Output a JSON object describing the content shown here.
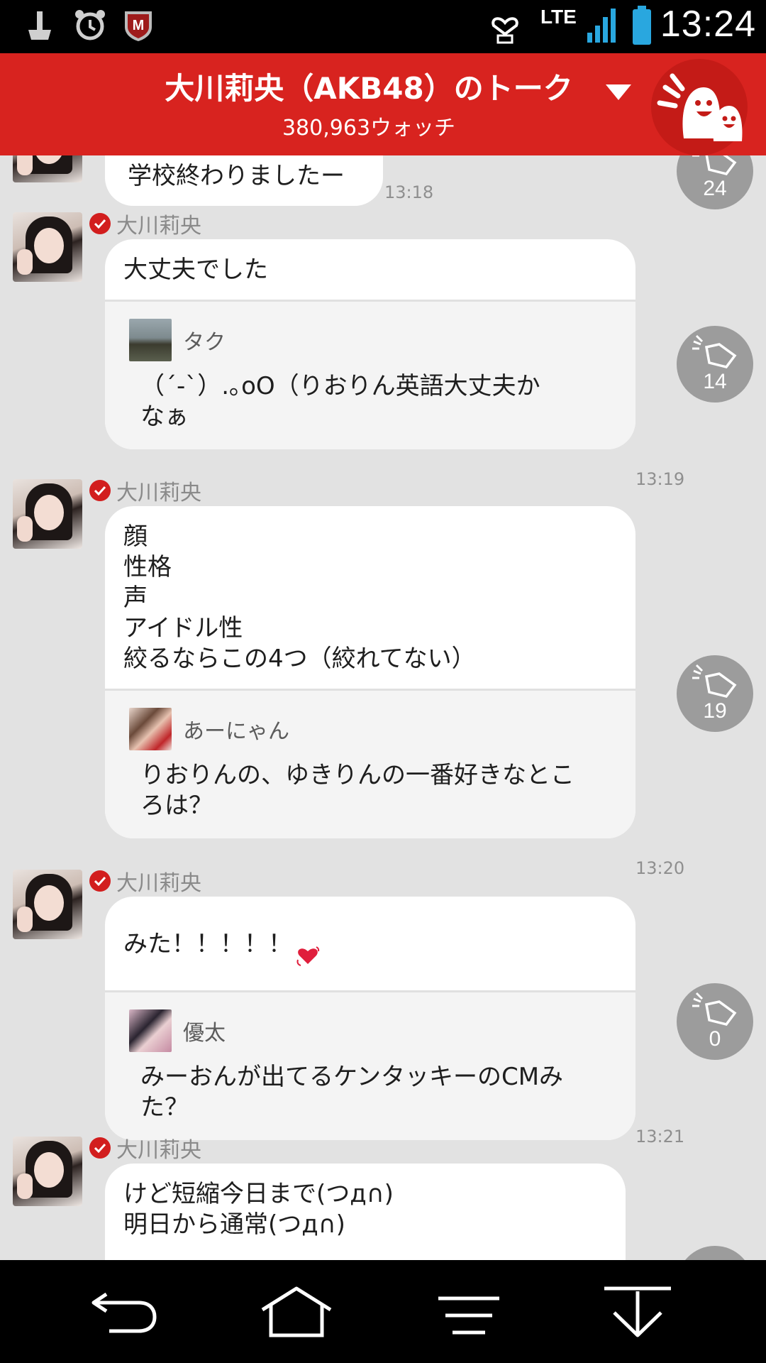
{
  "status_bar": {
    "time": "13:24",
    "network": "LTE",
    "icons": [
      "cleaner-icon",
      "alarm-clock-icon",
      "security-shield-icon",
      "heart-download-icon",
      "signal-icon",
      "battery-icon"
    ]
  },
  "header": {
    "title": "大川莉央（AKB48）のトーク",
    "watch_count": "380,963ウォッチ",
    "accent_color": "#d8231f"
  },
  "messages": [
    {
      "text": "学校終わりましたー",
      "time": "13:18",
      "claps": "24"
    },
    {
      "author": "大川莉央",
      "text": "大丈夫でした",
      "quote": {
        "user": "タク",
        "text": "（´-`）.｡oO（りおりん英語大丈夫か\nなぁ"
      },
      "time": "13:19",
      "claps": "14"
    },
    {
      "author": "大川莉央",
      "text": "顔\n性格\n声\nアイドル性\n絞るならこの4つ（絞れてない）",
      "quote": {
        "user": "あーにゃん",
        "text": "りおりんの、ゆきりんの一番好きなとこ\nろは？"
      },
      "time": "13:20",
      "claps": "19"
    },
    {
      "author": "大川莉央",
      "text": "みた！！！！！",
      "quote": {
        "user": "優太",
        "text": "みーおんが出てるケンタッキーのCMみ\nた？"
      },
      "time": "13:21",
      "claps": "0"
    },
    {
      "author": "大川莉央",
      "text": "けど短縮今日まで(つд∩)\n明日から通常(つд∩)"
    }
  ],
  "nav": [
    "back-icon",
    "home-icon",
    "menu-icon",
    "scroll-down-icon"
  ]
}
